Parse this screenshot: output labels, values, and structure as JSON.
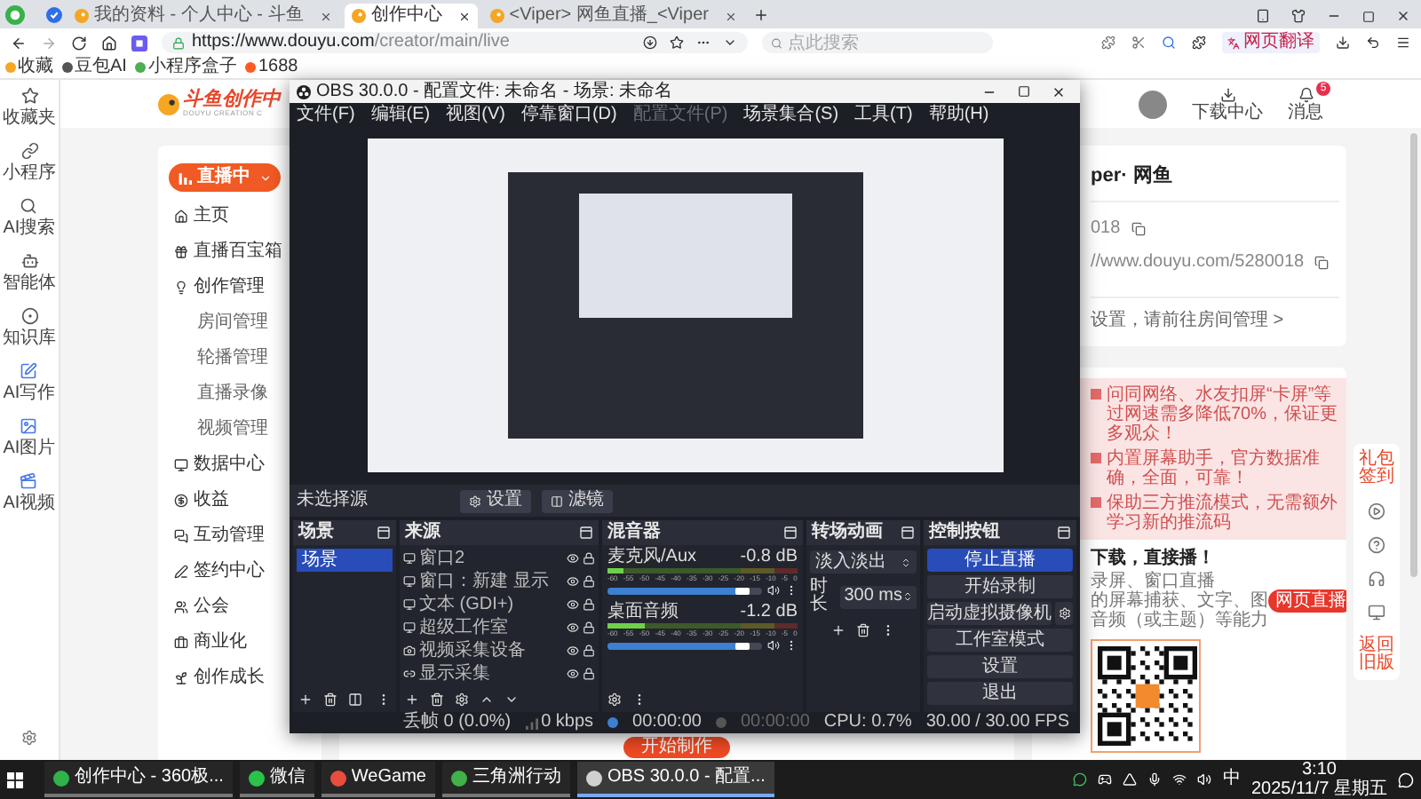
{
  "browser": {
    "tabs": [
      {
        "title": "我的资料 - 个人中心 - 斗鱼",
        "selected": false
      },
      {
        "title": "创作中心",
        "selected": true
      },
      {
        "title": "<Viper> 网鱼直播_<Viper",
        "selected": false
      }
    ],
    "url_host": "https://www.douyu.com",
    "url_path": "/creator/main/live",
    "search": {
      "placeholder": "点此搜索"
    },
    "translate_button": "网页翻译",
    "bookmarks": [
      "收藏",
      "豆包AI",
      "小程序盒子",
      "1688"
    ]
  },
  "side_rail": {
    "items": [
      {
        "label": "收藏夹",
        "kind": "star"
      },
      {
        "label": "小程序",
        "kind": "link"
      },
      {
        "label": "AI搜索",
        "kind": "search"
      },
      {
        "label": "智能体",
        "kind": "bot"
      },
      {
        "label": "知识库",
        "kind": "target"
      },
      {
        "label": "AI写作",
        "kind": "write"
      },
      {
        "label": "AI图片",
        "kind": "image"
      },
      {
        "label": "AI视频",
        "kind": "video"
      }
    ]
  },
  "header": {
    "logo": "斗鱼创作中",
    "logo_subtitle": "DOUYU CREATION C",
    "download": "下载中心",
    "messages": "消息",
    "badge": "5"
  },
  "nav": {
    "live_button": "直播中",
    "items": [
      {
        "label": "主页",
        "kind": "home"
      },
      {
        "label": "直播百宝箱",
        "kind": "toolbox"
      },
      {
        "label": "创作管理",
        "kind": "create"
      },
      {
        "label": "房间管理",
        "kind": "sub"
      },
      {
        "label": "轮播管理",
        "kind": "sub"
      },
      {
        "label": "直播录像",
        "kind": "sub"
      },
      {
        "label": "视频管理",
        "kind": "sub"
      },
      {
        "label": "数据中心",
        "kind": "data"
      },
      {
        "label": "收益",
        "kind": "income"
      },
      {
        "label": "互动管理",
        "kind": "interact"
      },
      {
        "label": "签约中心",
        "kind": "contract"
      },
      {
        "label": "公会",
        "kind": "guild"
      },
      {
        "label": "商业化",
        "kind": "business"
      },
      {
        "label": "创作成长",
        "kind": "growth"
      }
    ]
  },
  "start_button": "开始制作",
  "room_card": {
    "name": "per· 网鱼",
    "room_id": "018",
    "url": "//www.douyu.com/5280018",
    "hint": "设置，请前往房间管理 >"
  },
  "tips": [
    "问同网络、水友扣屏“卡屏”等过网速需多降低70%，保证更多观众！",
    "内置屏幕助手，官方数据准确，全面，可靠！",
    "保助三方推流模式，无需额外学习新的推流码"
  ],
  "download": {
    "title": "下载，直接播！",
    "desc": [
      "录屏、窗口直播",
      "的屏幕捕获、文字、图",
      "音频（或主题）等能力"
    ],
    "button": "网页直播"
  },
  "float_toolbar": {
    "top_label": "礼包签到",
    "bottom_label": "返回旧版"
  },
  "obs": {
    "title": "OBS 30.0.0 - 配置文件: 未命名 - 场景: 未命名",
    "menu": [
      {
        "label": "文件(F)",
        "disabled": false
      },
      {
        "label": "编辑(E)",
        "disabled": false
      },
      {
        "label": "视图(V)",
        "disabled": false
      },
      {
        "label": "停靠窗口(D)",
        "disabled": false
      },
      {
        "label": "配置文件(P)",
        "disabled": true
      },
      {
        "label": "场景集合(S)",
        "disabled": false
      },
      {
        "label": "工具(T)",
        "disabled": false
      },
      {
        "label": "帮助(H)",
        "disabled": false
      }
    ],
    "source_bar": {
      "label": "未选择源",
      "settings": "设置",
      "filters": "滤镜"
    },
    "scenes": {
      "title": "场景",
      "items": [
        {
          "label": "场景",
          "selected": true
        }
      ]
    },
    "sources": {
      "title": "来源",
      "items": [
        {
          "label": "窗口2",
          "kind": "window"
        },
        {
          "label": "窗口：新建 显示",
          "kind": "window"
        },
        {
          "label": "文本 (GDI+)",
          "kind": "window"
        },
        {
          "label": "超级工作室",
          "kind": "window"
        },
        {
          "label": "视频采集设备",
          "kind": "camera"
        },
        {
          "label": "显示采集",
          "kind": "display"
        }
      ]
    },
    "mixer": {
      "title": "混音器",
      "channels": [
        {
          "name": "麦克风/Aux",
          "reading": "-0.8 dB",
          "meter": {
            "level": 0.08
          },
          "volume": {
            "level": 0.92
          },
          "scale": [
            "-60",
            "-55",
            "-50",
            "-45",
            "-40",
            "-35",
            "-30",
            "-25",
            "-20",
            "-15",
            "-10",
            "-5",
            "0"
          ]
        },
        {
          "name": "桌面音频",
          "reading": "-1.2 dB",
          "meter": {
            "level": 0.2
          },
          "volume": {
            "level": 0.92
          },
          "scale": [
            "-60",
            "-55",
            "-50",
            "-45",
            "-40",
            "-35",
            "-30",
            "-25",
            "-20",
            "-15",
            "-10",
            "-5",
            "0"
          ]
        }
      ]
    },
    "transitions": {
      "title": "转场动画",
      "type": "淡入淡出",
      "duration_label": "时长",
      "duration": "300 ms"
    },
    "controls": {
      "title": "控制按钮",
      "buttons": [
        {
          "label": "停止直播",
          "active": true
        },
        {
          "label": "开始录制",
          "active": false
        },
        {
          "label": "启动虚拟摄像机",
          "active": false
        },
        {
          "label": "工作室模式",
          "active": false
        },
        {
          "label": "设置",
          "active": false
        },
        {
          "label": "退出",
          "active": false
        }
      ]
    },
    "status": {
      "dropped": "丢帧 0 (0.0%)",
      "bitrate": "0 kbps",
      "stream_time": "00:00:00",
      "streaming": true,
      "record_time": "00:00:00",
      "recording": false,
      "cpu": "CPU: 0.7%",
      "fps": "30.00 / 30.00 FPS"
    }
  },
  "taskbar": {
    "items": [
      {
        "label": "创作中心 - 360极...",
        "kind": "browser",
        "active": false
      },
      {
        "label": "微信",
        "kind": "chat",
        "active": false
      },
      {
        "label": "WeGame",
        "kind": "game",
        "active": false
      },
      {
        "label": "三角洲行动",
        "kind": "delta",
        "active": false
      },
      {
        "label": "OBS 30.0.0 - 配置...",
        "kind": "obs",
        "active": true
      }
    ],
    "ime": "中",
    "time": "3:10",
    "date": "2025/11/7 星期五"
  }
}
